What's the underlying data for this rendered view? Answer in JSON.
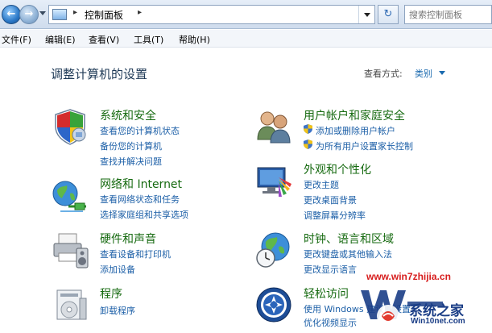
{
  "navbar": {
    "back_arrow": "←",
    "forward_arrow": "→",
    "address_separator": "▸",
    "address_text": "控制面板",
    "refresh_glyph": "↻",
    "search_placeholder": "搜索控制面板"
  },
  "menu": [
    "文件(F)",
    "编辑(E)",
    "查看(V)",
    "工具(T)",
    "帮助(H)"
  ],
  "content": {
    "title": "调整计算机的设置",
    "view_label": "查看方式:",
    "view_value": "类别"
  },
  "categories": [
    {
      "title": "系统和安全",
      "icon": "shield-icon",
      "links": [
        "查看您的计算机状态",
        "备份您的计算机",
        "查找并解决问题"
      ]
    },
    {
      "title": "网络和 Internet",
      "icon": "network-globe-icon",
      "links": [
        "查看网络状态和任务",
        "选择家庭组和共享选项"
      ]
    },
    {
      "title": "硬件和声音",
      "icon": "printer-icon",
      "links": [
        "查看设备和打印机",
        "添加设备"
      ]
    },
    {
      "title": "程序",
      "icon": "programs-icon",
      "links": [
        "卸载程序"
      ]
    },
    {
      "title": "用户帐户和家庭安全",
      "icon": "users-icon",
      "links": [
        "添加或删除用户帐户",
        "为所有用户设置家长控制"
      ]
    },
    {
      "title": "外观和个性化",
      "icon": "monitor-palette-icon",
      "links": [
        "更改主题",
        "更改桌面背景",
        "调整屏幕分辨率"
      ]
    },
    {
      "title": "时钟、语言和区域",
      "icon": "clock-globe-icon",
      "links": [
        "更改键盘或其他输入法",
        "更改显示语言"
      ]
    },
    {
      "title": "轻松访问",
      "icon": "ease-of-access-icon",
      "links": [
        "使用 Windows 建议的设置",
        "优化视频显示"
      ]
    }
  ],
  "watermark": {
    "site": "www.win7zhijia.cn",
    "brand": "系统之家",
    "sub": "Win10net.com"
  },
  "colors": {
    "category_title": "#166a10",
    "link": "#1c5fa7",
    "watermark_red": "#d71d1d",
    "watermark_blue": "#1a3d86"
  }
}
